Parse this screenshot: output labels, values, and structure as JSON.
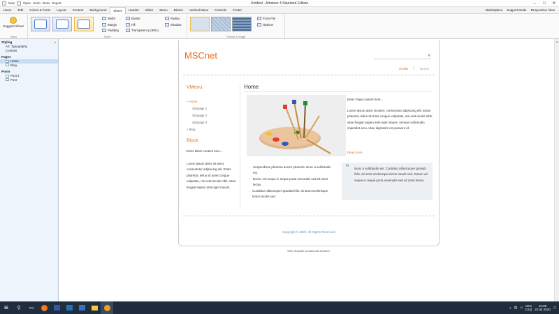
{
  "window": {
    "title": "Untitled - Artisteer 4 Standard Edition",
    "quick_access": [
      "New",
      "Open",
      "Undo",
      "Redo",
      "Export"
    ]
  },
  "menu": {
    "tabs": [
      "Home",
      "Edit",
      "Colors & Fonts",
      "Layout",
      "Content",
      "Background",
      "Sheet",
      "Header",
      "Slider",
      "Menu",
      "Blocks",
      "Vertical Menu",
      "Controls",
      "Footer"
    ],
    "active_tab": "Sheet",
    "right_links": [
      "Marketplace",
      "Support Mode",
      "Responsive View"
    ]
  },
  "ribbon": {
    "suggest_label": "Suggest Sheet",
    "suggest_group": "Ideas",
    "sheet_group": "Sheet",
    "texture_group": "Texture & Image",
    "col1": [
      "Width",
      "Margin",
      "Padding"
    ],
    "col2": [
      "Border",
      "Fill",
      "Transparency (30%)"
    ],
    "col3": [
      "Radius",
      "Shadow"
    ],
    "col4": [
      "From File",
      "Options"
    ]
  },
  "left_panel": {
    "styling_header": "Styling",
    "styling_items": [
      "Art. Typography",
      "Controls"
    ],
    "pages_header": "Pages",
    "pages_items": [
      "Home",
      "Blog"
    ],
    "posts_header": "Posts",
    "posts_items": [
      "Post 2",
      "Post"
    ]
  },
  "site": {
    "logo": "MSCnet",
    "search_placeholder": "",
    "nav": [
      "HOME",
      "BLOG"
    ],
    "vmenu_title": "VMenu",
    "vmenu_items": [
      "Home",
      "Subpage 1",
      "Subpage 2",
      "Subpage 3",
      "Blog"
    ],
    "block_title": "Block",
    "block_text": "Enter Block content here...",
    "block_lorem": "Lorem ipsum dolor sit amet, consectetur adipiscing elit. Etiam pharetra, tellus sit amet congue vulputate, nisi erat iaculis nibh, vitae feugiat sapien ante eget mauris.",
    "home_title": "Home",
    "intro": "Enter Page content here...",
    "main_lorem": "Lorem ipsum dolor sit amet, consectetur adipiscing elit. Etiam pharetra, tellus sit amet congue vulputate, nisi erat iaculis nibh, vitae feugiat sapien ante eget mauris. Aenean sollicitudin imperdiet arcu, vitae dignissim est posuere id.",
    "read_more": "Read more",
    "bullets": [
      "Suspendisse pharetra auctor pharetra. Nunc a sollicitudin est.",
      "Donec vel neque in neque porta venenatis sed sit amet lectus.",
      "Curabitur ullamcorper gravida felis, sit amet scelerisque lorem iaculis sed."
    ],
    "quote": "Nunc a sollicitudin est. Curabitur ullamcorper gravida felis, sit amet scelerisque lorem iaculis sed. Donec vel neque in neque porta venenatis sed sit amet lectus.",
    "copyright": "Copyright © 2020. All Rights Reserved.",
    "credit": "Web Template created with Artisteer."
  },
  "taskbar": {
    "lang_top": "CES",
    "lang_bottom": "CSQ",
    "time": "10:05",
    "date": "22.02.2020"
  },
  "colors": {
    "accent": "#e2701f",
    "taskbar": "#1f2d3d",
    "panel": "#eef4fb"
  }
}
